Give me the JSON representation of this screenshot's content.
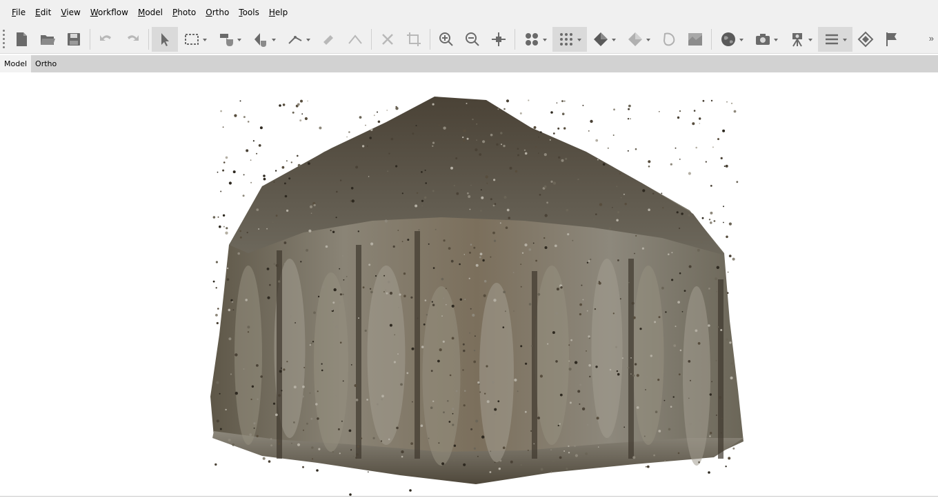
{
  "menu": {
    "items": [
      {
        "label": "File",
        "mnemonic": "F",
        "rest": "ile"
      },
      {
        "label": "Edit",
        "mnemonic": "E",
        "rest": "dit"
      },
      {
        "label": "View",
        "mnemonic": "V",
        "rest": "iew"
      },
      {
        "label": "Workflow",
        "mnemonic": "W",
        "rest": "orkflow"
      },
      {
        "label": "Model",
        "mnemonic": "M",
        "rest": "odel"
      },
      {
        "label": "Photo",
        "mnemonic": "P",
        "rest": "hoto"
      },
      {
        "label": "Ortho",
        "mnemonic": "O",
        "rest": "rtho"
      },
      {
        "label": "Tools",
        "mnemonic": "T",
        "rest": "ools"
      },
      {
        "label": "Help",
        "mnemonic": "H",
        "rest": "elp"
      }
    ]
  },
  "toolbar": {
    "buttons": [
      {
        "name": "new-document-icon",
        "type": "plain"
      },
      {
        "name": "open-folder-icon",
        "type": "plain"
      },
      {
        "name": "save-icon",
        "type": "plain"
      },
      {
        "name": "sep"
      },
      {
        "name": "undo-icon",
        "type": "plain",
        "disabled": true
      },
      {
        "name": "redo-icon",
        "type": "plain",
        "disabled": true
      },
      {
        "name": "sep"
      },
      {
        "name": "select-arrow-icon",
        "type": "plain",
        "active": true
      },
      {
        "name": "rectangle-selection-icon",
        "type": "drop"
      },
      {
        "name": "navigation-hand-icon",
        "type": "drop"
      },
      {
        "name": "rotate-object-icon",
        "type": "drop"
      },
      {
        "name": "ruler-icon",
        "type": "drop"
      },
      {
        "name": "draw-shape-icon",
        "type": "plain",
        "disabled": true
      },
      {
        "name": "polyline-icon",
        "type": "plain",
        "disabled": true
      },
      {
        "name": "sep"
      },
      {
        "name": "delete-selection-icon",
        "type": "plain",
        "disabled": true
      },
      {
        "name": "crop-icon",
        "type": "plain",
        "disabled": true
      },
      {
        "name": "sep"
      },
      {
        "name": "zoom-in-icon",
        "type": "plain"
      },
      {
        "name": "zoom-out-icon",
        "type": "plain"
      },
      {
        "name": "reset-view-icon",
        "type": "plain"
      },
      {
        "name": "sep"
      },
      {
        "name": "point-cloud-icon",
        "type": "drop"
      },
      {
        "name": "dense-cloud-icon",
        "type": "drop",
        "active": true
      },
      {
        "name": "shaded-model-icon",
        "type": "drop"
      },
      {
        "name": "textured-model-icon",
        "type": "drop"
      },
      {
        "name": "tiled-model-icon",
        "type": "plain"
      },
      {
        "name": "dem-icon",
        "type": "plain"
      },
      {
        "name": "sep"
      },
      {
        "name": "globe-icon",
        "type": "drop"
      },
      {
        "name": "camera-icon",
        "type": "drop"
      },
      {
        "name": "camera-tripod-icon",
        "type": "drop"
      },
      {
        "name": "list-icon",
        "type": "drop",
        "active": true
      },
      {
        "name": "region-icon",
        "type": "plain"
      },
      {
        "name": "marker-flag-icon",
        "type": "plain"
      }
    ],
    "overflow": "»"
  },
  "tabs": [
    {
      "label": "Model",
      "active": true
    },
    {
      "label": "Ortho",
      "active": false
    }
  ],
  "colors": {
    "chrome": "#f0f0f0",
    "tabbar": "#d2d2d2",
    "viewport_bg": "#ffffff",
    "icon_gray": "#6a6a6a",
    "model_dark": "#4a4236",
    "model_mid": "#7c7466",
    "model_light": "#a39d90"
  }
}
